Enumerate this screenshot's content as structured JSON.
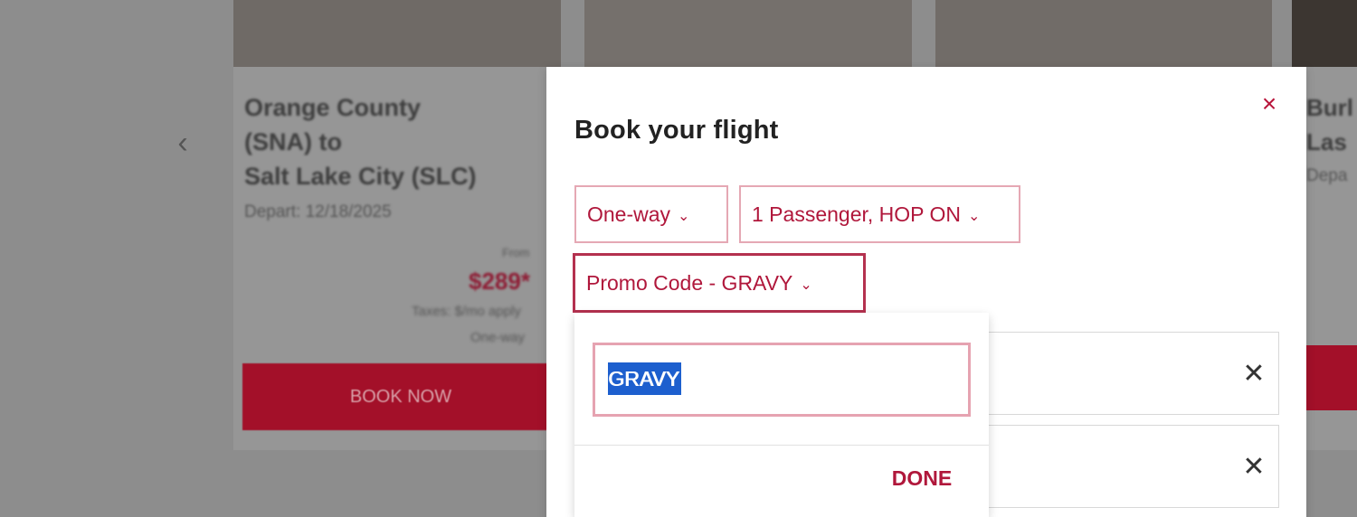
{
  "background": {
    "carousel_prev": "‹",
    "card": {
      "route_line1": "Orange County",
      "route_line2": "(SNA) to",
      "route_line3": "Salt Lake City (SLC)",
      "depart": "Depart: 12/18/2025",
      "from_label": "From",
      "price": "$289*",
      "taxes": "Taxes: $/mo apply",
      "oneway": "One-way",
      "book_now": "BOOK NOW"
    },
    "right_card": {
      "route": "Burl\nLas",
      "depart": "Depa"
    }
  },
  "modal": {
    "close_icon": "×",
    "title": "Book your flight",
    "trip_type": "One-way",
    "passengers": "1 Passenger, HOP ON",
    "promo_label": "Promo Code - GRAVY",
    "chevron_icon": "⌄",
    "row_clear_icon": "✕"
  },
  "promo_dropdown": {
    "input_value": "GRAVY",
    "done_label": "DONE"
  },
  "colors": {
    "brand_red": "#b0173b",
    "selection_blue": "#1d5fce",
    "overlay_gray": "#8d8d8d"
  }
}
